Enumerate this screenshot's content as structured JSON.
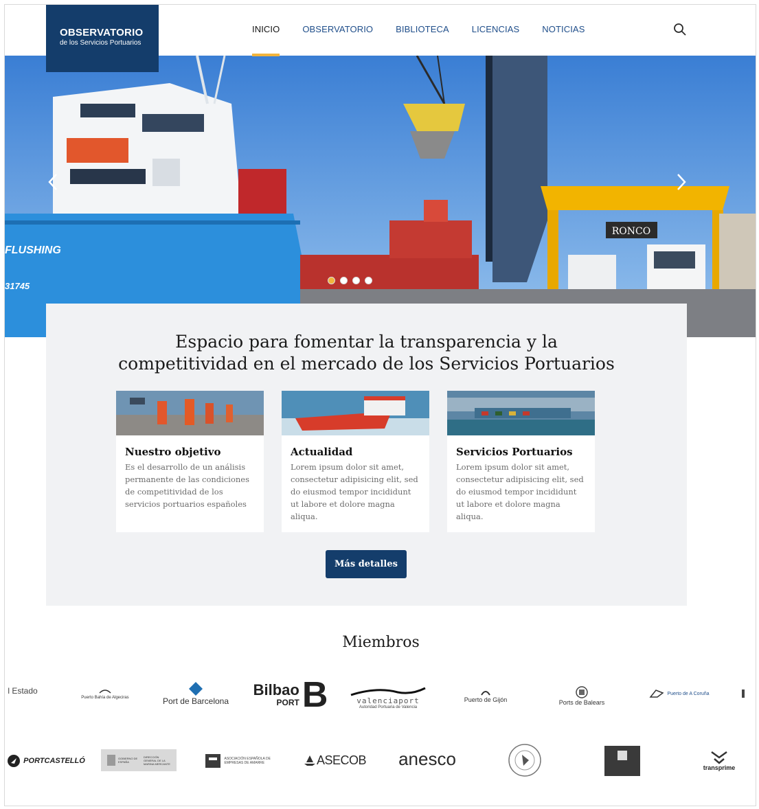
{
  "brand": {
    "title": "OBSERVATORIO",
    "subtitle": "de los Servicios Portuarios"
  },
  "nav": {
    "items": [
      "INICIO",
      "OBSERVATORIO",
      "BIBLIOTECA",
      "LICENCIAS",
      "NOTICIAS"
    ],
    "active": "INICIO"
  },
  "hero": {
    "ship_name": "FLUSHING",
    "ship_number": "31745",
    "crane_brand": "RONCO",
    "slide_count": 4,
    "active_slide": 1
  },
  "intro": {
    "headline": "Espacio para fomentar la transparencia y la competitividad en el mercado de los Servicios Portuarios"
  },
  "cards": [
    {
      "title": "Nuestro objetivo",
      "text": "Es el desarrollo de un análisis permanente de las condiciones de competitividad de los servicios portuarios españoles"
    },
    {
      "title": "Actualidad",
      "text": "Lorem ipsum dolor sit amet, consectetur adipisicing elit, sed do eiusmod tempor incididunt ut labore et dolore magna aliqua."
    },
    {
      "title": "Servicios Portuarios",
      "text": "Lorem ipsum dolor sit amet, consectetur adipisicing elit, sed do eiusmod tempor incididunt ut labore et dolore magna aliqua."
    }
  ],
  "cta": {
    "label": "Más detalles"
  },
  "members": {
    "title": "Miembros",
    "row1": [
      "l Estado",
      "Puerto Bahía de Algeciras",
      "Port de Barcelona",
      "Bilbao",
      "PORT",
      "B",
      "valenciaport",
      "Autoridad Portuaria de Valencia",
      "Puerto de Gijón",
      "Ports de Balears",
      "Puerto de A Coruña"
    ],
    "row2": [
      "PORTCASTELLÓ",
      "GOBIERNO DE ESPAÑA",
      "DIRECCIÓN GENERAL DE LA MARINA MERCANTE",
      "ASOCIACIÓN ESPAÑOLA DE EMPRESAS DE AMARRE",
      "ASECOB",
      "anesco",
      "transprime"
    ]
  },
  "colors": {
    "brand_navy": "#143d6b",
    "accent_gold": "#f2b43c",
    "nav_blue": "#1f4e8a",
    "panel_bg": "#f1f2f4"
  },
  "icons": {
    "search": "search-icon",
    "prev": "chevron-left-icon",
    "next": "chevron-right-icon"
  }
}
